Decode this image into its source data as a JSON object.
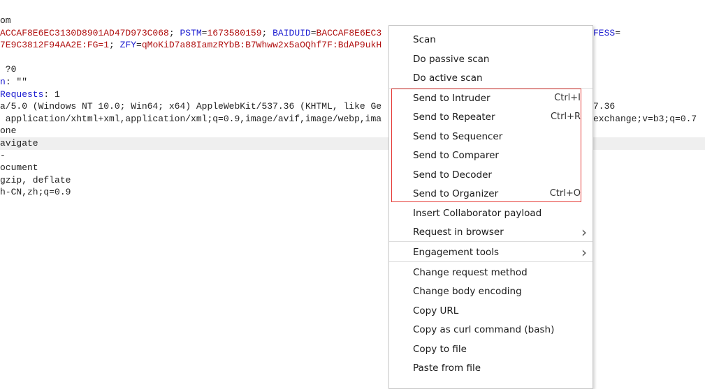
{
  "editor": {
    "lines": [
      {
        "text": "om"
      },
      {
        "segments": [
          {
            "t": "ACCAF8E6EC3130D8901AD47D973C068",
            "c": "v"
          },
          {
            "t": "; ",
            "c": "p"
          },
          {
            "t": "PSTM",
            "c": "k"
          },
          {
            "t": "=",
            "c": "p"
          },
          {
            "t": "1673580159",
            "c": "v"
          },
          {
            "t": "; ",
            "c": "p"
          },
          {
            "t": "BAIDUID",
            "c": "k"
          },
          {
            "t": "=",
            "c": "p"
          },
          {
            "t": "BACCAF8E6EC3",
            "c": "v"
          }
        ],
        "right": [
          {
            "t": "FESS",
            "c": "k"
          },
          {
            "t": "=",
            "c": "p"
          }
        ]
      },
      {
        "segments": [
          {
            "t": "7E9C3812F94AA2E:FG=1",
            "c": "v"
          },
          {
            "t": "; ",
            "c": "p"
          },
          {
            "t": "ZFY",
            "c": "k"
          },
          {
            "t": "=",
            "c": "p"
          },
          {
            "t": "qMoKiD7a88IamzRYbB:B7Whww2x5aOQhf7F:BdAP9ukH",
            "c": "v"
          }
        ]
      },
      {
        "text": ""
      },
      {
        "text": " ?0"
      },
      {
        "segments": [
          {
            "t": "n",
            "c": "k"
          },
          {
            "t": ": \"\"",
            "c": "p"
          }
        ]
      },
      {
        "segments": [
          {
            "t": "Requests",
            "c": "k"
          },
          {
            "t": ": 1",
            "c": "p"
          }
        ]
      },
      {
        "text": "a/5.0 (Windows NT 10.0; Win64; x64) AppleWebKit/537.36 (KHTML, like Ge",
        "right": [
          {
            "t": "7.36",
            "c": "p"
          }
        ]
      },
      {
        "text": " application/xhtml+xml,application/xml;q=0.9,image/avif,image/webp,ima",
        "right": [
          {
            "t": "exchange;v=b3;q=0.7",
            "c": "p"
          }
        ]
      },
      {
        "text": "one"
      },
      {
        "text": "avigate",
        "highlight": true
      },
      {
        "text": "-"
      },
      {
        "text": "ocument"
      },
      {
        "text": "gzip, deflate"
      },
      {
        "text": "h-CN,zh;q=0.9"
      }
    ]
  },
  "context_menu": {
    "items": [
      {
        "label": "Scan"
      },
      {
        "label": "Do passive scan"
      },
      {
        "label": "Do active scan",
        "sep_after": true
      },
      {
        "label": "Send to Intruder",
        "shortcut": "Ctrl+I"
      },
      {
        "label": "Send to Repeater",
        "shortcut": "Ctrl+R"
      },
      {
        "label": "Send to Sequencer"
      },
      {
        "label": "Send to Comparer"
      },
      {
        "label": "Send to Decoder"
      },
      {
        "label": "Send to Organizer",
        "shortcut": "Ctrl+O"
      },
      {
        "label": "Insert Collaborator payload"
      },
      {
        "label": "Request in browser",
        "submenu": true,
        "sep_after": true
      },
      {
        "label": "Engagement tools",
        "submenu": true,
        "sep_after": true
      },
      {
        "label": "Change request method"
      },
      {
        "label": "Change body encoding"
      },
      {
        "label": "Copy URL"
      },
      {
        "label": "Copy as curl command (bash)"
      },
      {
        "label": "Copy to file"
      },
      {
        "label": "Paste from file"
      }
    ],
    "highlight_color": "#e53935"
  }
}
